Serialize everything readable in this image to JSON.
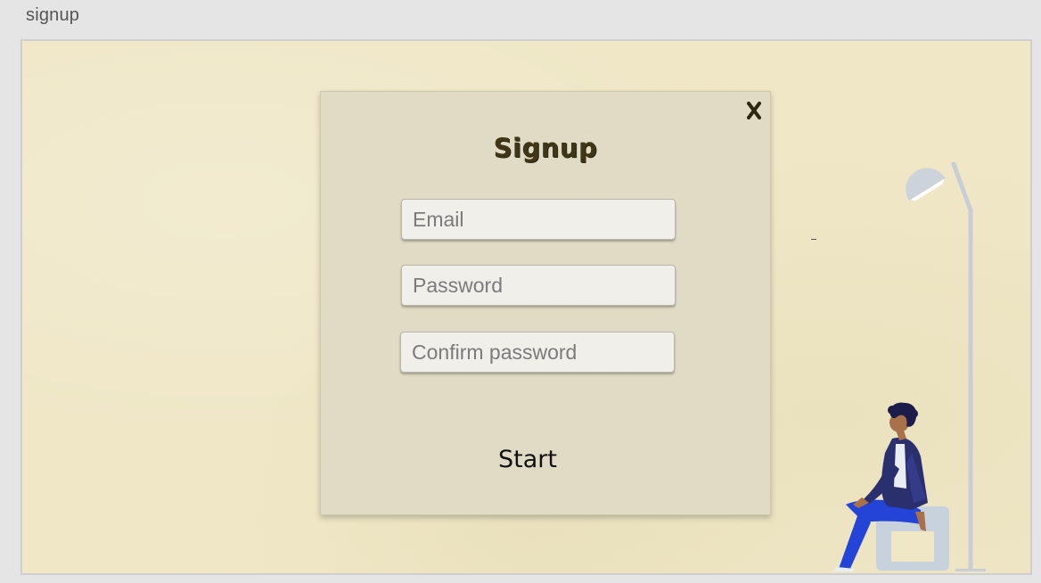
{
  "frame": {
    "label": "signup"
  },
  "dialog": {
    "title": "Signup",
    "close_icon": "close-icon",
    "fields": {
      "email": {
        "placeholder": "Email",
        "value": ""
      },
      "password": {
        "placeholder": "Password",
        "value": ""
      },
      "confirm_password": {
        "placeholder": "Confirm password",
        "value": ""
      }
    },
    "start_label": "Start"
  },
  "illustration": {
    "name": "person-sitting-with-floor-lamp-illustration"
  },
  "colors": {
    "page_background": "#e5e5e5",
    "canvas_background": "#efe7c6",
    "dialog_background": "#e0dbc4",
    "title_color": "#3f3519",
    "figure_jacket": "#2a2f6e",
    "figure_pants": "#2344d6",
    "lamp_color": "#c9ced4"
  }
}
